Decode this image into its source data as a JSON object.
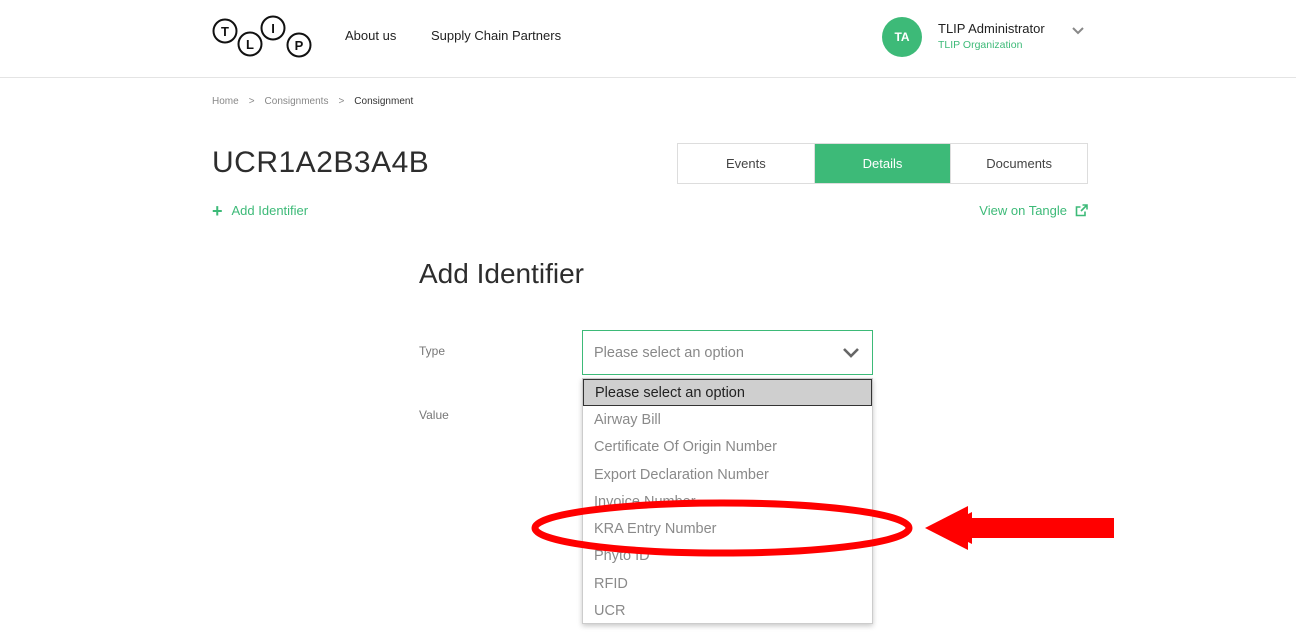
{
  "header": {
    "logo_letters": [
      "T",
      "L",
      "I",
      "P"
    ],
    "nav": [
      {
        "label": "About us"
      },
      {
        "label": "Supply Chain Partners"
      }
    ],
    "user": {
      "initials": "TA",
      "name": "TLIP Administrator",
      "organization": "TLIP Organization"
    }
  },
  "breadcrumb": {
    "items": [
      "Home",
      "Consignments",
      "Consignment"
    ],
    "separator": ">"
  },
  "page": {
    "title": "UCR1A2B3A4B",
    "tabs": [
      {
        "label": "Events",
        "active": false
      },
      {
        "label": "Details",
        "active": true
      },
      {
        "label": "Documents",
        "active": false
      }
    ],
    "add_identifier": "Add Identifier",
    "view_on_tangle": "View on Tangle"
  },
  "form": {
    "title": "Add Identifier",
    "type_label": "Type",
    "value_label": "Value",
    "select_value": "Please select an option",
    "options": [
      "Please select an option",
      "Airway Bill",
      "Certificate Of Origin Number",
      "Export Declaration Number",
      "Invoice Number",
      "KRA Entry Number",
      "Phyto ID",
      "RFID",
      "UCR"
    ],
    "selected_index": 0
  },
  "colors": {
    "brand_green": "#3dba78",
    "annotation_red": "#ff0000"
  },
  "icons": {
    "plus": "plus-icon",
    "external_link": "external-link-icon",
    "chevron": "chevron-down-icon"
  }
}
